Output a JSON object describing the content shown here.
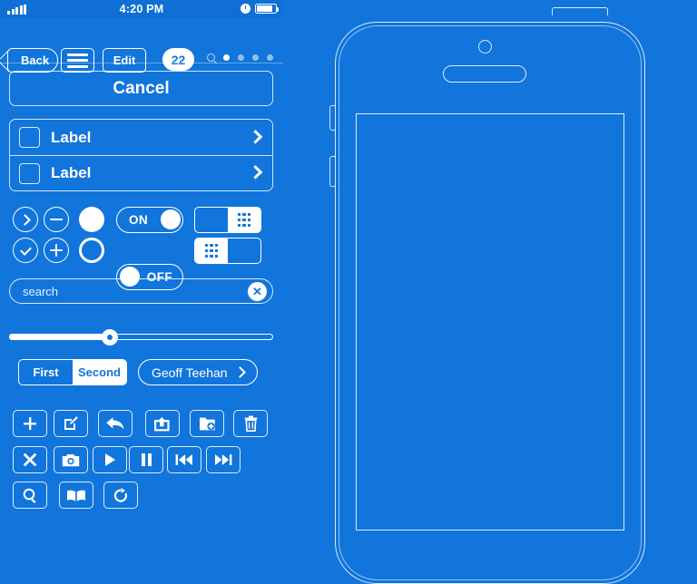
{
  "meta": {
    "background_color": "#1175DB",
    "line_color": "#FFFFFF",
    "statusbar_color": "#0F6FD4"
  },
  "statusbar": {
    "signal_icon": "signal-bars-icon",
    "time": "4:20 PM",
    "alarm_icon": "alarm-clock-icon",
    "battery_icon": "battery-icon"
  },
  "navbar": {
    "back_label": "Back",
    "menu_icon": "hamburger-menu-icon",
    "edit_label": "Edit",
    "badge_count": "22",
    "search_icon": "search-icon",
    "page_dots": 4,
    "active_dot_index": 0
  },
  "cancel_button": {
    "label": "Cancel"
  },
  "table": {
    "rows": [
      {
        "label": "Label",
        "checkbox_icon": "checkbox-icon",
        "disclosure_icon": "chevron-right-icon"
      },
      {
        "label": "Label",
        "checkbox_icon": "checkbox-icon",
        "disclosure_icon": "chevron-right-icon"
      }
    ]
  },
  "controls": {
    "row1": {
      "chevron_circle_icon": "chevron-right-circle-icon",
      "minus_circle_icon": "minus-circle-icon",
      "filled_circle_icon": "radio-filled-icon",
      "toggle_on_label": "ON",
      "segmented_keypad_icon": "keypad-grid-icon",
      "segmented_selected": "right"
    },
    "row2": {
      "check_circle_icon": "checkmark-circle-icon",
      "plus_circle_icon": "plus-circle-icon",
      "empty_circle_icon": "radio-empty-icon",
      "toggle_off_label": "OFF",
      "segmented_keypad_icon": "keypad-grid-icon",
      "segmented_selected": "left"
    }
  },
  "search_field": {
    "placeholder": "search",
    "value": "",
    "clear_icon": "clear-circle-icon",
    "clear_glyph": "✕"
  },
  "slider": {
    "value_percent": 38,
    "knob_icon": "slider-knob-icon"
  },
  "segmented_control": {
    "options": [
      "First",
      "Second"
    ],
    "selected_index": 1
  },
  "person_pill": {
    "label": "Geoff Teehan",
    "disclosure_icon": "chevron-right-icon"
  },
  "toolbar": {
    "row1": [
      {
        "name": "add-button",
        "icon": "plus-icon"
      },
      {
        "name": "compose-button",
        "icon": "compose-icon"
      },
      {
        "name": "reply-button",
        "icon": "reply-arrow-icon"
      },
      {
        "name": "share-button",
        "icon": "share-export-icon"
      },
      {
        "name": "organize-button",
        "icon": "folder-move-icon"
      },
      {
        "name": "delete-button",
        "icon": "trash-icon"
      }
    ],
    "row2": [
      {
        "name": "close-button",
        "icon": "close-x-icon"
      },
      {
        "name": "camera-button",
        "icon": "camera-icon"
      },
      {
        "name": "play-button",
        "icon": "play-icon"
      },
      {
        "name": "pause-button",
        "icon": "pause-icon"
      },
      {
        "name": "previous-button",
        "icon": "rewind-icon"
      },
      {
        "name": "next-button",
        "icon": "fast-forward-icon"
      }
    ],
    "row3": [
      {
        "name": "search-button",
        "icon": "magnifier-icon"
      },
      {
        "name": "bookmarks-button",
        "icon": "book-icon"
      },
      {
        "name": "refresh-button",
        "icon": "refresh-icon"
      }
    ]
  },
  "phone_mockup": {
    "power_button_icon": "power-button-icon",
    "camera_icon": "front-camera-icon",
    "speaker_icon": "earpiece-speaker-icon",
    "screen_icon": "phone-screen-outline",
    "silent_switch_icon": "silent-switch-icon",
    "volume_button_icon": "volume-button-icon"
  }
}
